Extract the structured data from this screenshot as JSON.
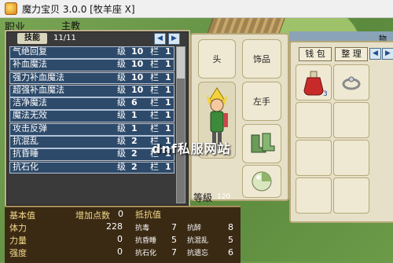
{
  "window": {
    "title": "魔力宝贝 3.0.0 [牧羊座 X]"
  },
  "menu": {
    "job": "职业",
    "main": "主教"
  },
  "skills": {
    "tab_label": "技能",
    "count": "11/11",
    "level_label": "级",
    "slot_label": "栏",
    "items": [
      {
        "name": "气绝回复",
        "level": "10",
        "slots": "1"
      },
      {
        "name": "补血魔法",
        "level": "10",
        "slots": "1"
      },
      {
        "name": "强力补血魔法",
        "level": "10",
        "slots": "1"
      },
      {
        "name": "超强补血魔法",
        "level": "10",
        "slots": "1"
      },
      {
        "name": "洁净魔法",
        "level": "6",
        "slots": "1"
      },
      {
        "name": "魔法无效",
        "level": "1",
        "slots": "1"
      },
      {
        "name": "攻击反弹",
        "level": "1",
        "slots": "1"
      },
      {
        "name": "抗混乱",
        "level": "2",
        "slots": "1"
      },
      {
        "name": "抗昏睡",
        "level": "2",
        "slots": "1"
      },
      {
        "name": "抗石化",
        "level": "2",
        "slots": "1"
      }
    ]
  },
  "equipment": {
    "head": "头",
    "neck": "饰品",
    "left_hand": "左手",
    "level_label": "等級",
    "level_value": "120"
  },
  "inventory": {
    "title": "物",
    "tab_wallet": "钱 包",
    "tab_sort": "整 理",
    "item_qty": "3"
  },
  "stats": {
    "base_label": "基本值",
    "bonus_label": "增加点数",
    "bonus_value": "0",
    "resist_label": "抵抗值",
    "rows": [
      {
        "label": "体力",
        "value": "228"
      },
      {
        "label": "力量",
        "value": "0"
      },
      {
        "label": "强度",
        "value": "0"
      }
    ],
    "resists": [
      {
        "a_label": "抗毒",
        "a_value": "7",
        "b_label": "抗醉",
        "b_value": "8"
      },
      {
        "a_label": "抗昏睡",
        "a_value": "5",
        "b_label": "抗混乱",
        "b_value": "5"
      },
      {
        "a_label": "抗石化",
        "a_value": "7",
        "b_label": "抗遗忘",
        "b_value": "6"
      }
    ]
  },
  "watermark": "dnf私服网站"
}
